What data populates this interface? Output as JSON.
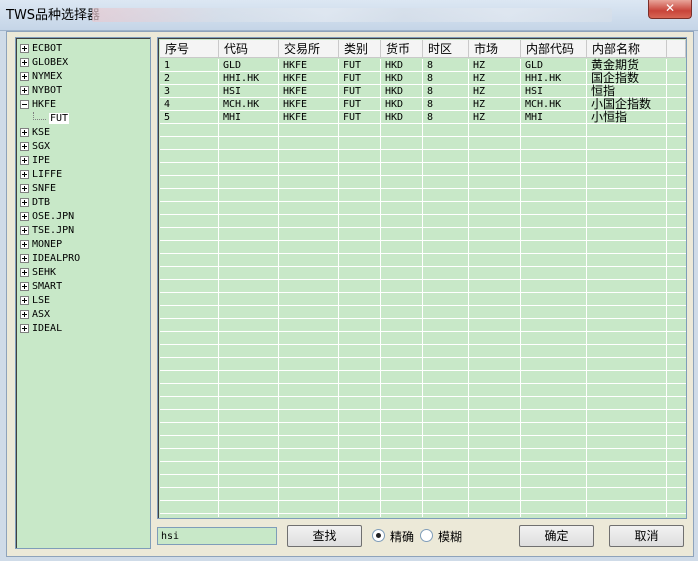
{
  "window": {
    "title": "TWS品种选择器",
    "close_label": "✕"
  },
  "tree": {
    "nodes": [
      {
        "label": "ECBOT",
        "expanded": false
      },
      {
        "label": "GLOBEX",
        "expanded": false
      },
      {
        "label": "NYMEX",
        "expanded": false
      },
      {
        "label": "NYBOT",
        "expanded": false
      },
      {
        "label": "HKFE",
        "expanded": true,
        "children": [
          "FUT"
        ]
      },
      {
        "label": "KSE",
        "expanded": false
      },
      {
        "label": "SGX",
        "expanded": false
      },
      {
        "label": "IPE",
        "expanded": false
      },
      {
        "label": "LIFFE",
        "expanded": false
      },
      {
        "label": "SNFE",
        "expanded": false
      },
      {
        "label": "DTB",
        "expanded": false
      },
      {
        "label": "OSE.JPN",
        "expanded": false
      },
      {
        "label": "TSE.JPN",
        "expanded": false
      },
      {
        "label": "MONEP",
        "expanded": false
      },
      {
        "label": "IDEALPRO",
        "expanded": false
      },
      {
        "label": "SEHK",
        "expanded": false
      },
      {
        "label": "SMART",
        "expanded": false
      },
      {
        "label": "LSE",
        "expanded": false
      },
      {
        "label": "ASX",
        "expanded": false
      },
      {
        "label": "IDEAL",
        "expanded": false
      }
    ]
  },
  "grid": {
    "columns": [
      "序号",
      "代码",
      "交易所",
      "类别",
      "货币",
      "时区",
      "市场",
      "内部代码",
      "内部名称"
    ],
    "rows": [
      [
        "1",
        "GLD",
        "HKFE",
        "FUT",
        "HKD",
        "8",
        "HZ",
        "GLD",
        "黄金期货"
      ],
      [
        "2",
        "HHI.HK",
        "HKFE",
        "FUT",
        "HKD",
        "8",
        "HZ",
        "HHI.HK",
        "国企指数"
      ],
      [
        "3",
        "HSI",
        "HKFE",
        "FUT",
        "HKD",
        "8",
        "HZ",
        "HSI",
        "恒指"
      ],
      [
        "4",
        "MCH.HK",
        "HKFE",
        "FUT",
        "HKD",
        "8",
        "HZ",
        "MCH.HK",
        "小国企指数"
      ],
      [
        "5",
        "MHI",
        "HKFE",
        "FUT",
        "HKD",
        "8",
        "HZ",
        "MHI",
        "小恒指"
      ]
    ]
  },
  "search": {
    "value": "hsi"
  },
  "buttons": {
    "find": "查找",
    "ok": "确定",
    "cancel": "取消"
  },
  "match_mode": {
    "exact": "精确",
    "fuzzy": "模糊",
    "selected": "exact"
  }
}
